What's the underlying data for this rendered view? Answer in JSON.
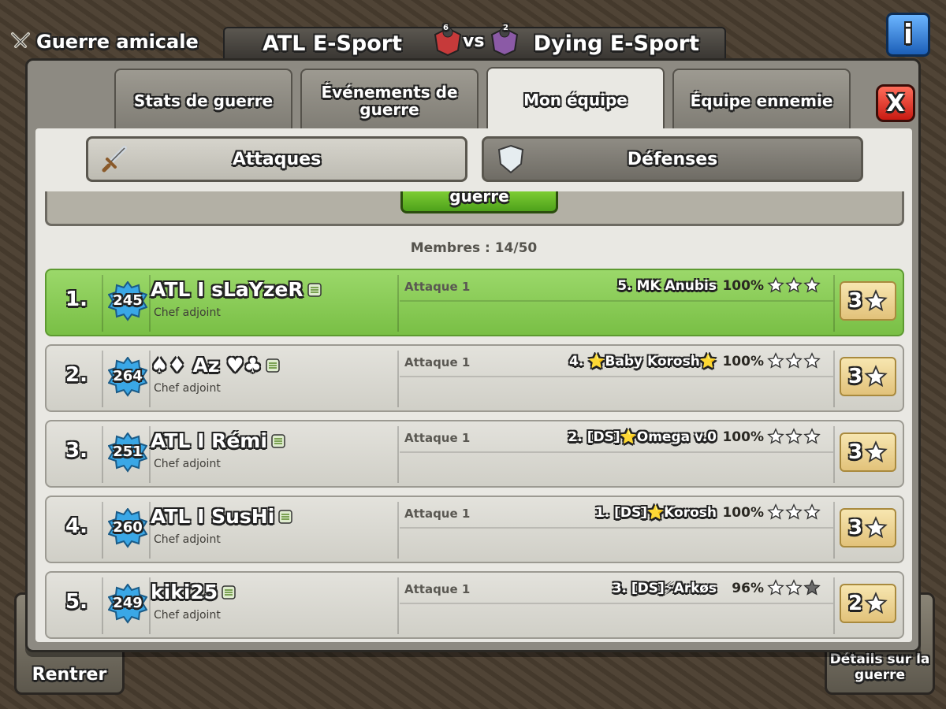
{
  "header": {
    "war_type_label": "Guerre amicale",
    "clan_left": "ATL E-Sport",
    "clan_right": "Dying E-Sport",
    "vs_label": "vs",
    "badge_left_level": "6",
    "badge_right_level": "2",
    "info_label": "i"
  },
  "background_buttons": {
    "return_label": "Rentrer",
    "war_details_label": "Détails sur la guerre"
  },
  "tabs": [
    {
      "label": "Stats de guerre"
    },
    {
      "label": "Événements de guerre"
    },
    {
      "label": "Mon équipe",
      "active": true
    },
    {
      "label": "Équipe ennemie"
    }
  ],
  "close_label": "X",
  "subtabs": {
    "attacks": "Attaques",
    "defenses": "Défenses"
  },
  "summary_button_label": "guerre",
  "members_count": "Membres  : 14/50",
  "members": [
    {
      "rank": "1.",
      "level": "245",
      "name": "ATL I sLaYzeR",
      "role": "Chef adjoint",
      "attack_label": "Attaque 1",
      "target": "5. MK Anubis",
      "percent": "100%",
      "attack_stars": 3,
      "stars_total": "3",
      "highlight": true
    },
    {
      "rank": "2.",
      "level": "264",
      "name": "♠♦ Az ♥♣",
      "role": "Chef adjoint",
      "attack_label": "Attaque 1",
      "target": "4. ⭐Baby Korosh⭐",
      "percent": "100%",
      "attack_stars": 3,
      "stars_total": "3",
      "highlight": false
    },
    {
      "rank": "3.",
      "level": "251",
      "name": "ATL I Rémi",
      "role": "Chef adjoint",
      "attack_label": "Attaque 1",
      "target": "2. [DS]⭐Omega v.0",
      "percent": "100%",
      "attack_stars": 3,
      "stars_total": "3",
      "highlight": false
    },
    {
      "rank": "4.",
      "level": "260",
      "name": "ATL I SusHi",
      "role": "Chef adjoint",
      "attack_label": "Attaque 1",
      "target": "1. [DS]⭐Korosh",
      "percent": "100%",
      "attack_stars": 3,
      "stars_total": "3",
      "highlight": false
    },
    {
      "rank": "5.",
      "level": "249",
      "name": "kiki25",
      "role": "Chef adjoint",
      "attack_label": "Attaque 1",
      "target": "3. [DS]⚡Arkøs",
      "percent": "96%",
      "attack_stars": 2,
      "stars_total": "2",
      "highlight": false
    }
  ],
  "colors": {
    "highlight_row": "#8ccb58",
    "star_gold": "#ffffff",
    "star_empty": "#6b6b6b"
  }
}
